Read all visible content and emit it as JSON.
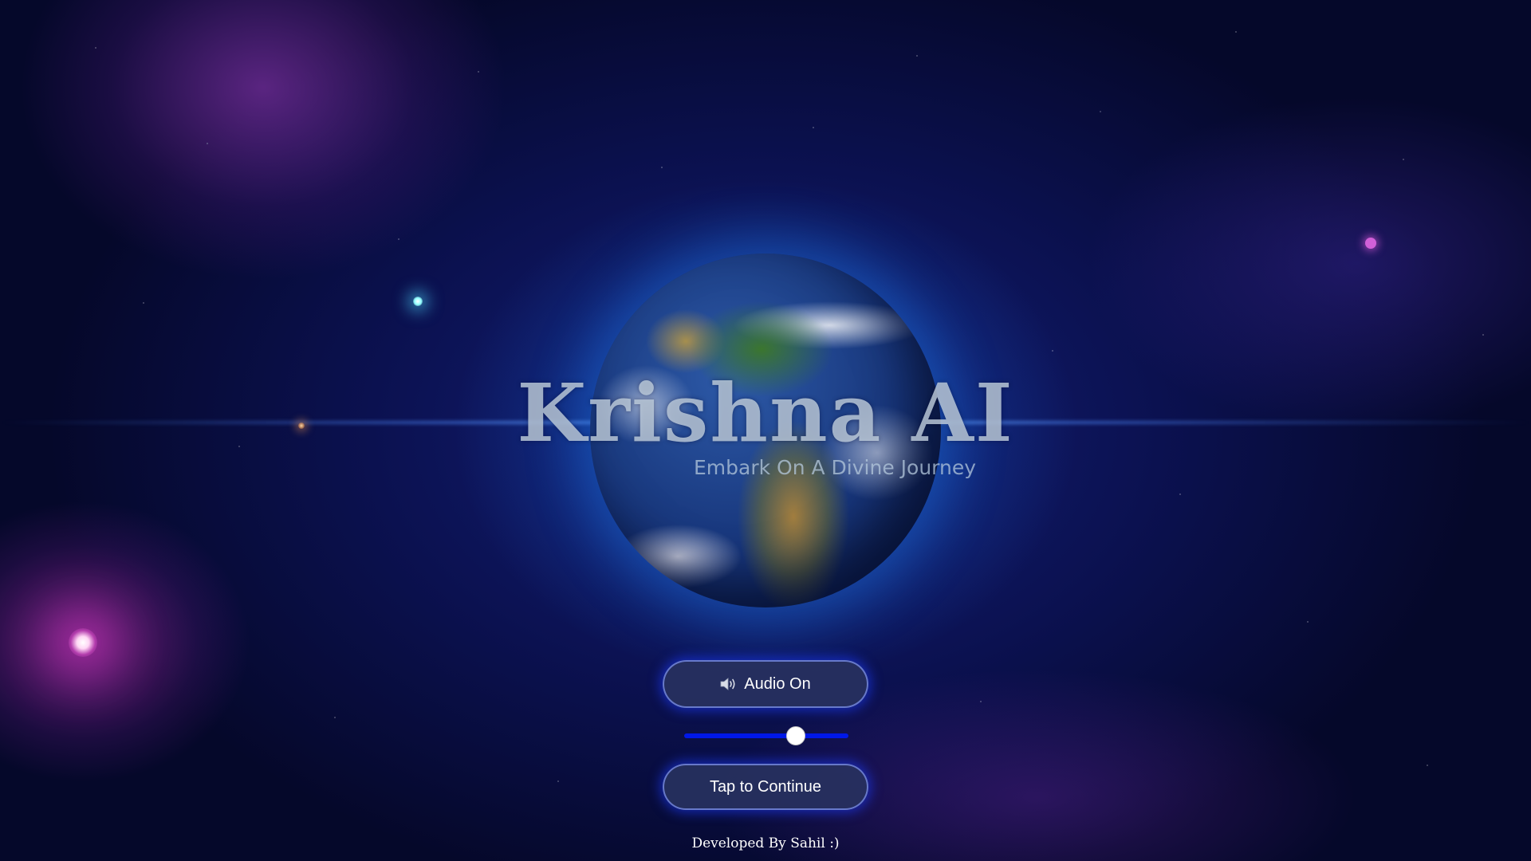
{
  "app": {
    "title": "Krishna AI",
    "subtitle": "Embark On A Divine Journey"
  },
  "audio_button": {
    "icon": "speaker-icon",
    "label": "Audio On"
  },
  "volume_slider": {
    "value_fraction": 0.68
  },
  "continue_button": {
    "label": "Tap to Continue"
  },
  "footer": {
    "credit": "Developed By Sahil :)"
  },
  "colors": {
    "slider_track": "#0018e8",
    "button_glow": "#1e3cff",
    "button_fill": "#28325f"
  }
}
